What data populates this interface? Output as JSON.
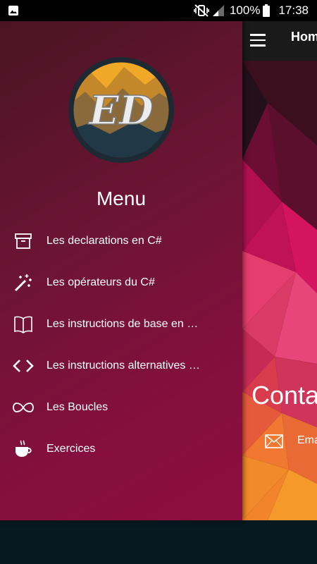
{
  "status_bar": {
    "battery": "100%",
    "time": "17:38"
  },
  "toolbar": {
    "title": "Home"
  },
  "contact": {
    "title": "Contact",
    "email_label": "Email"
  },
  "drawer": {
    "heading": "Menu",
    "logo_text": "ED",
    "items": [
      {
        "label": "Les declarations en C#",
        "icon": "archive-box-icon"
      },
      {
        "label": "Les opérateurs du C#",
        "icon": "magic-wand-icon"
      },
      {
        "label": "Les instructions de base en …",
        "icon": "open-book-icon"
      },
      {
        "label": "Les instructions alternatives …",
        "icon": "code-brackets-icon"
      },
      {
        "label": "Les Boucles",
        "icon": "infinity-icon"
      },
      {
        "label": "Exercices",
        "icon": "coffee-cup-icon"
      }
    ]
  },
  "colors": {
    "drawer_top": "#4a1424",
    "drawer_bottom": "#8c0e3f",
    "logo_sun": "#f0a828",
    "logo_mountain": "#213947"
  }
}
